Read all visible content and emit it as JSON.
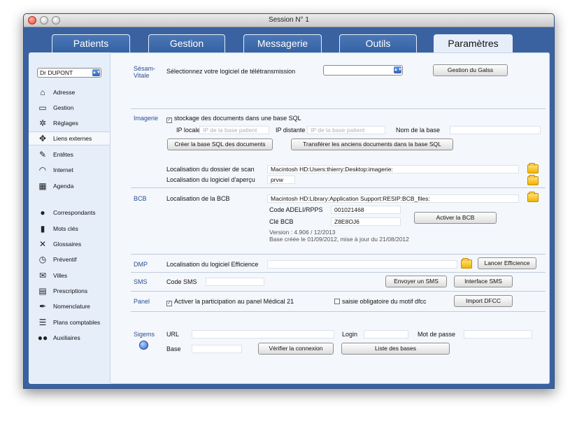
{
  "window": {
    "title": "Session N° 1"
  },
  "tabs": [
    {
      "label": "Patients",
      "active": false
    },
    {
      "label": "Gestion",
      "active": false
    },
    {
      "label": "Messagerie",
      "active": false
    },
    {
      "label": "Outils",
      "active": false
    },
    {
      "label": "Paramètres",
      "active": true
    }
  ],
  "sidebar": {
    "doctor": "Dr DUPONT",
    "items": [
      {
        "label": "Adresse",
        "icon": "house-icon"
      },
      {
        "label": "Gestion",
        "icon": "inbox-icon"
      },
      {
        "label": "Réglages",
        "icon": "gear-icon"
      },
      {
        "label": "Liens externes",
        "icon": "expand-arrows-icon",
        "selected": true
      },
      {
        "label": "Entêtes",
        "icon": "pencil-edit-icon"
      },
      {
        "label": "Internet",
        "icon": "wifi-icon"
      },
      {
        "label": "Agenda",
        "icon": "calendar-icon"
      },
      {
        "label": "Correspondants",
        "icon": "person-icon"
      },
      {
        "label": "Mots clés",
        "icon": "bar-chart-icon"
      },
      {
        "label": "Glossaires",
        "icon": "tools-icon"
      },
      {
        "label": "Préventif",
        "icon": "clock-icon"
      },
      {
        "label": "Villes",
        "icon": "envelope-icon"
      },
      {
        "label": "Prescriptions",
        "icon": "document-list-icon"
      },
      {
        "label": "Nomenclature",
        "icon": "pen-icon"
      },
      {
        "label": "Plans comptables",
        "icon": "list-icon"
      },
      {
        "label": "Auxiliaires",
        "icon": "people-icon"
      }
    ]
  },
  "sesam": {
    "section": "Sésam-\nVitale",
    "label": "Sélectionnez votre logiciel de télétransmission",
    "select_value": "",
    "button": "Gestion du Galss"
  },
  "imagerie": {
    "section": "Imagerie",
    "checkbox_label": "stockage des documents dans une base SQL",
    "ip_locale_label": "IP locale",
    "ip_locale_placeholder": "IP de la base patient",
    "ip_distante_label": "IP distante",
    "ip_distante_placeholder": "IP de la base patient",
    "nom_base_label": "Nom de la base",
    "nom_base_value": "",
    "btn_create": "Créer la base SQL des documents",
    "btn_transfer": "Transférer les anciens documents dans la base SQL",
    "scan_label": "Localisation du dossier de scan",
    "scan_value": "Macintosh HD:Users:thierry:Desktop:imagerie:",
    "preview_label": "Localisation du logiciel d'aperçu",
    "preview_value": "prvw"
  },
  "bcb": {
    "section": "BCB",
    "label": "Localisation de la BCB",
    "path": "Macintosh HD:Library:Application Support:RESIP:BCB_files:",
    "code_label": "Code ADELI/RPPS",
    "code_value": "001021468",
    "cle_label": "Clé BCB",
    "cle_value": "Z8E8OJ6",
    "button": "Activer la BCB",
    "version": "Version : 4.906 / 12/2013",
    "created": "Base créée le 01/09/2012, mise à jour du 21/08/2012"
  },
  "dmp": {
    "section": "DMP",
    "label": "Localisation du logiciel Efficience",
    "value": "",
    "button": "Lancer Efficience"
  },
  "sms": {
    "section": "SMS",
    "label": "Code SMS",
    "value": "",
    "btn_send": "Envoyer un SMS",
    "btn_interface": "Interface SMS"
  },
  "panel_sec": {
    "section": "Panel",
    "checkbox_label": "Activer la participation au panel Médical 21",
    "checkbox2_label": "saisie obligatoire du motif dfcc",
    "button": "Import DFCC"
  },
  "sigems": {
    "section": "Sigems",
    "url_label": "URL",
    "url_value": "",
    "login_label": "Login",
    "login_value": "",
    "mdp_label": "Mot de passe",
    "mdp_value": "",
    "base_label": "Base",
    "base_value": "",
    "btn_verify": "Vérifier la connexion",
    "btn_list": "Liste des bases"
  }
}
